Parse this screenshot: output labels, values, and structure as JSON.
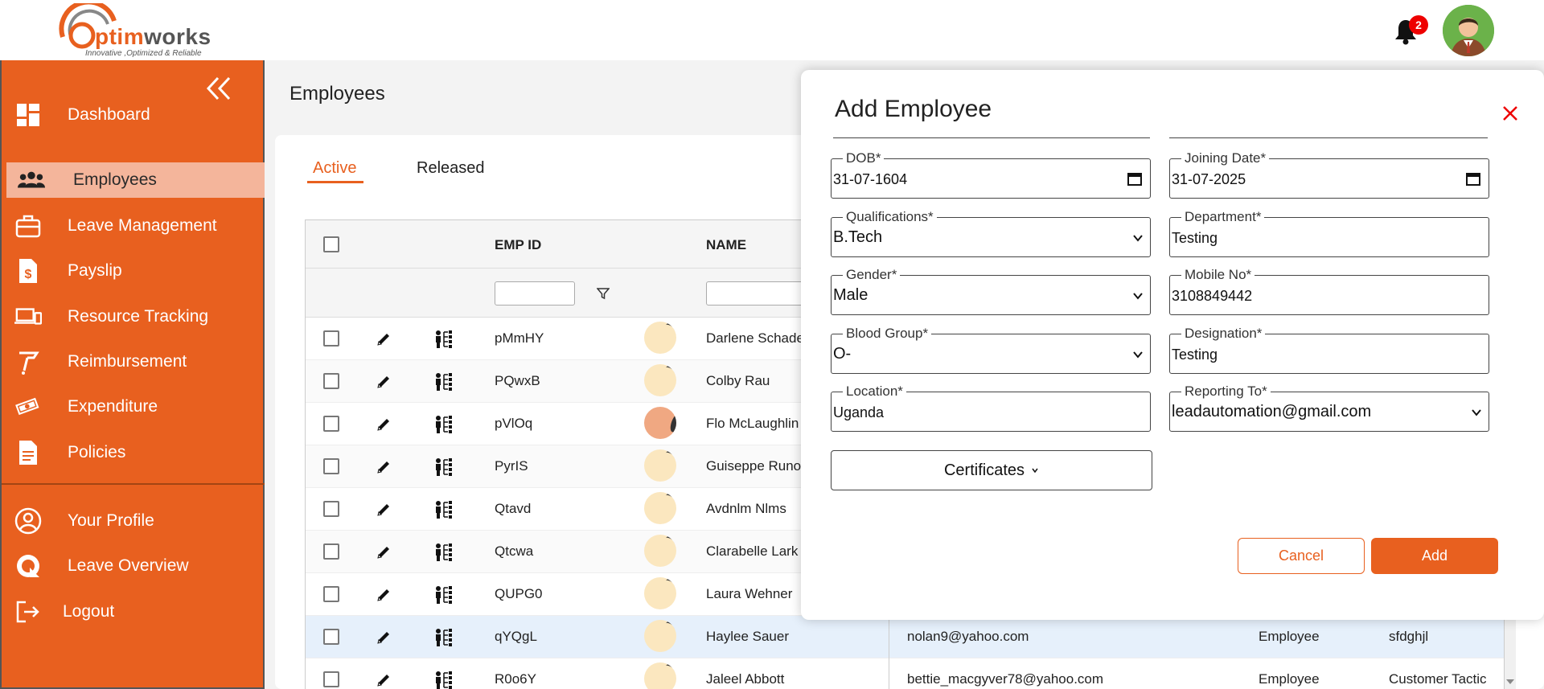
{
  "header": {
    "brand": {
      "first": "O",
      "rest_orange": "ptim",
      "rest_gray": "works",
      "tagline": "Innovative ,Optimized & Reliable"
    },
    "notification_count": "2"
  },
  "sidebar": {
    "items": [
      {
        "label": "Dashboard",
        "icon": "dashboard-icon"
      },
      {
        "label": "Employees",
        "icon": "people-icon"
      },
      {
        "label": "Leave Management",
        "icon": "briefcase-icon"
      },
      {
        "label": "Payslip",
        "icon": "payslip-icon"
      },
      {
        "label": "Resource Tracking",
        "icon": "devices-icon"
      },
      {
        "label": "Reimbursement",
        "icon": "reimbursement-icon"
      },
      {
        "label": "Expenditure",
        "icon": "money-icon"
      },
      {
        "label": "Policies",
        "icon": "document-icon"
      },
      {
        "label": "Your Profile",
        "icon": "profile-icon"
      },
      {
        "label": "Leave Overview",
        "icon": "leave-overview-icon"
      },
      {
        "label": "Logout",
        "icon": "logout-icon"
      }
    ]
  },
  "main": {
    "title": "Employees",
    "tabs": [
      {
        "label": "Active"
      },
      {
        "label": "Released"
      }
    ],
    "columns": {
      "emp_id": "EMP ID",
      "name": "NAME"
    },
    "rows": [
      {
        "emp_id": "pMmHY",
        "name": "Darlene Schade",
        "email": "",
        "role": "",
        "designation": ""
      },
      {
        "emp_id": "PQwxB",
        "name": "Colby Rau",
        "email": "",
        "role": "",
        "designation": ""
      },
      {
        "emp_id": "pVlOq",
        "name": "Flo McLaughlin",
        "email": "",
        "role": "",
        "designation": ""
      },
      {
        "emp_id": "PyrIS",
        "name": "Guiseppe Runo",
        "email": "",
        "role": "",
        "designation": ""
      },
      {
        "emp_id": "Qtavd",
        "name": "Avdnlm Nlms",
        "email": "",
        "role": "",
        "designation": ""
      },
      {
        "emp_id": "Qtcwa",
        "name": "Clarabelle Lark",
        "email": "",
        "role": "",
        "designation": ""
      },
      {
        "emp_id": "QUPG0",
        "name": "Laura Wehner",
        "email": "",
        "role": "",
        "designation": ""
      },
      {
        "emp_id": "qYQgL",
        "name": "Haylee Sauer",
        "email": "nolan9@yahoo.com",
        "role": "Employee",
        "designation": "sfdghjl"
      },
      {
        "emp_id": "R0o6Y",
        "name": "Jaleel Abbott",
        "email": "bettie_macgyver78@yahoo.com",
        "role": "Employee",
        "designation": "Customer Tactic"
      }
    ]
  },
  "modal": {
    "title": "Add Employee",
    "fields": {
      "dob": {
        "label": "DOB*",
        "value": "31-07-1604"
      },
      "joining_date": {
        "label": "Joining Date*",
        "value": "31-07-2025"
      },
      "qualifications": {
        "label": "Qualifications*",
        "value": "B.Tech"
      },
      "department": {
        "label": "Department*",
        "value": "Testing"
      },
      "gender": {
        "label": "Gender*",
        "value": "Male"
      },
      "mobile": {
        "label": "Mobile No*",
        "value": "3108849442"
      },
      "blood_group": {
        "label": "Blood Group*",
        "value": "O-"
      },
      "designation": {
        "label": "Designation*",
        "value": "Testing"
      },
      "location": {
        "label": "Location*",
        "value": "Uganda"
      },
      "reporting_to": {
        "label": "Reporting To*",
        "value": "leadautomation@gmail.com"
      }
    },
    "certificates_label": "Certificates",
    "cancel_label": "Cancel",
    "add_label": "Add"
  },
  "colors": {
    "accent": "#e8601f",
    "active_nav": "#f4b59b",
    "selected_row": "#e6f0fb"
  }
}
